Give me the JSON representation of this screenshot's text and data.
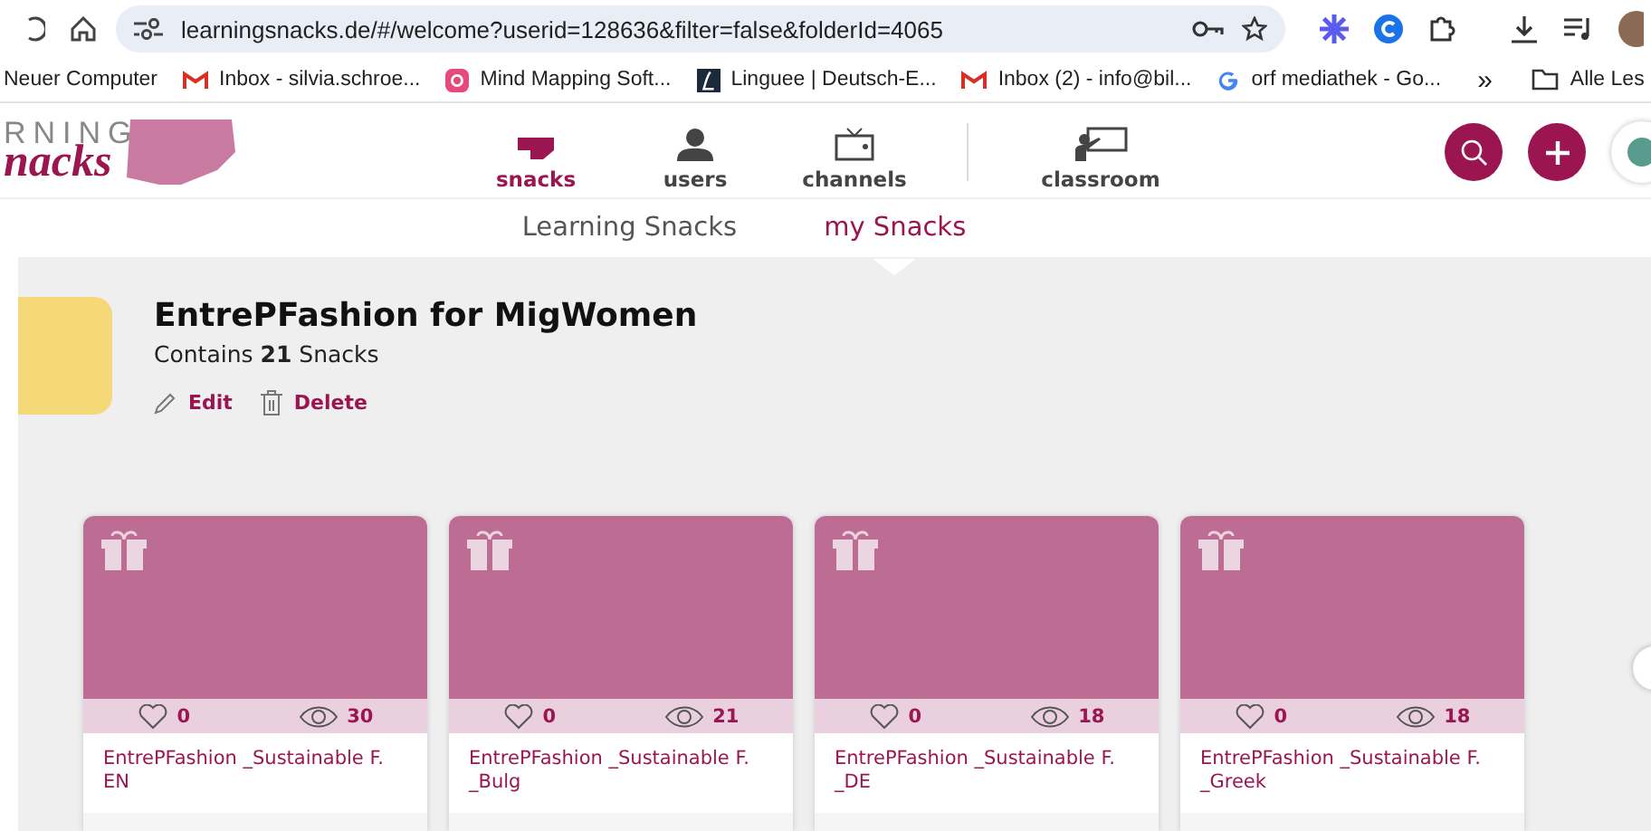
{
  "browser": {
    "url": "learningsnacks.de/#/welcome?userid=128636&filter=false&folderId=4065",
    "bookmarks": [
      {
        "label": "Neuer Computer",
        "kind": "none"
      },
      {
        "label": "Inbox - silvia.schroe...",
        "kind": "mail"
      },
      {
        "label": "Mind Mapping Soft...",
        "kind": "mindmap"
      },
      {
        "label": "Linguee | Deutsch-E...",
        "kind": "linguee"
      },
      {
        "label": "Inbox (2) - info@bil...",
        "kind": "mail"
      },
      {
        "label": "orf mediathek - Go...",
        "kind": "google"
      }
    ],
    "more": "»",
    "folder_bookmark": "Alle Les"
  },
  "app": {
    "logo": {
      "top": "RNING",
      "bottom": "nacks"
    },
    "nav": [
      {
        "label": "snacks",
        "kind": "snacks",
        "selected": true
      },
      {
        "label": "users",
        "kind": "users",
        "selected": false
      },
      {
        "label": "channels",
        "kind": "channels",
        "selected": false
      },
      {
        "label": "classroom",
        "kind": "classroom",
        "selected": false
      }
    ],
    "tabs": [
      {
        "label": "Learning Snacks",
        "selected": false
      },
      {
        "label": "my Snacks",
        "selected": true
      }
    ]
  },
  "folder": {
    "title": "EntrePFashion for MigWomen",
    "contains": "Contains **21** Snacks",
    "actions": [
      {
        "label": "Edit",
        "kind": "edit"
      },
      {
        "label": "Delete",
        "kind": "delete"
      }
    ]
  },
  "cards": [
    {
      "likes": "0",
      "views": "30",
      "title": "EntrePFashion _Sustainable F. EN"
    },
    {
      "likes": "0",
      "views": "21",
      "title": "EntrePFashion _Sustainable F. _Bulg"
    },
    {
      "likes": "0",
      "views": "18",
      "title": "EntrePFashion _Sustainable F. _DE"
    },
    {
      "likes": "0",
      "views": "18",
      "title": "EntrePFashion _Sustainable F. _Greek"
    }
  ]
}
